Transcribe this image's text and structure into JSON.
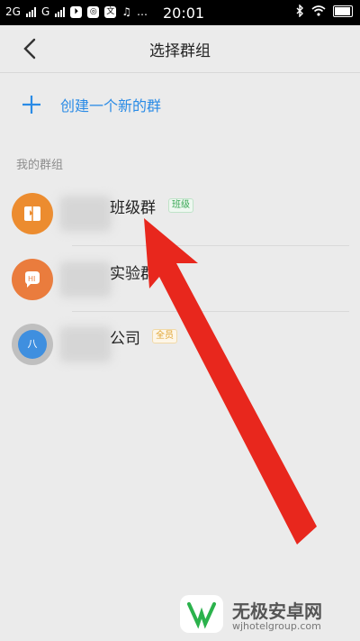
{
  "status_bar": {
    "sim1": "2G",
    "sim2": "G",
    "icon_app1": "⏵",
    "icon_app2": "◎",
    "icon_app3": "文",
    "icon_app4": "♫",
    "dots": "…",
    "time": "20:01"
  },
  "navbar": {
    "title": "选择群组"
  },
  "create": {
    "label": "创建一个新的群"
  },
  "section": {
    "label": "我的群组"
  },
  "groups": [
    {
      "name": "班级群",
      "tag": "班级",
      "avatar_color": "#ec8c2f"
    },
    {
      "name": "实验群",
      "tag": "",
      "avatar_color": "#ea7c3d"
    },
    {
      "name": "公司",
      "tag": "全员",
      "avatar_color": "#3f8fdf",
      "avatar_letter": "八"
    }
  ],
  "watermark": {
    "name": "无极安卓网",
    "url": "wjhotelgroup.com"
  },
  "colors": {
    "accent": "#2a8be6",
    "arrow": "#e8271d"
  }
}
